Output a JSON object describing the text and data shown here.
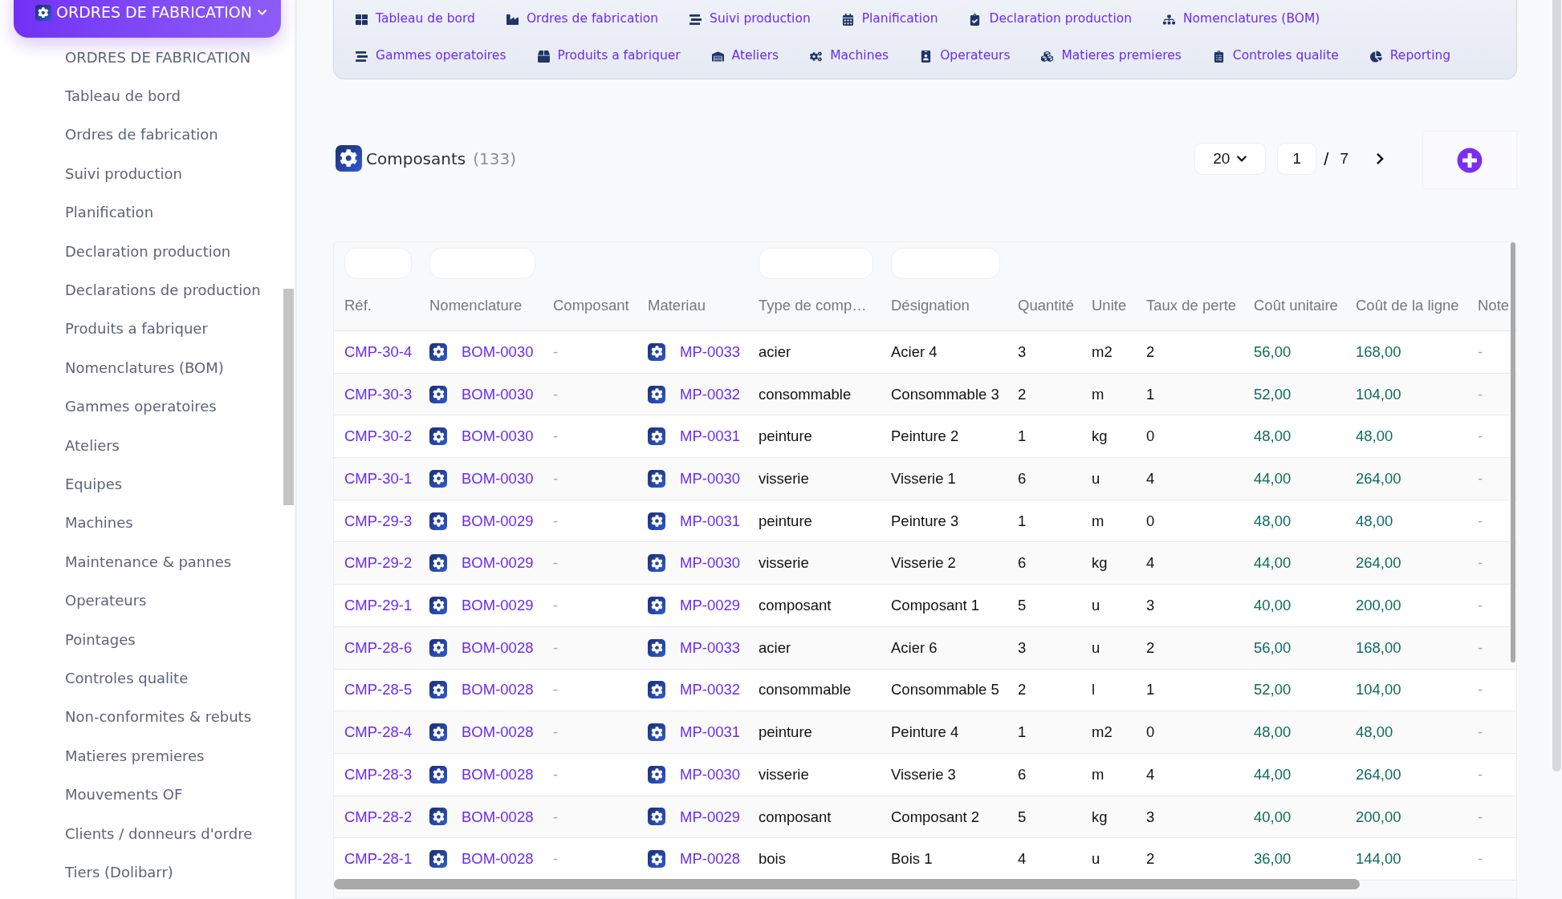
{
  "sidebar": {
    "header": {
      "title": "ORDRES DE FABRICATION"
    },
    "items": [
      "ORDRES DE FABRICATION",
      "Tableau de bord",
      "Ordres de fabrication",
      "Suivi production",
      "Planification",
      "Declaration production",
      "Declarations de production",
      "Produits a fabriquer",
      "Nomenclatures (BOM)",
      "Gammes operatoires",
      "Ateliers",
      "Equipes",
      "Machines",
      "Maintenance & pannes",
      "Operateurs",
      "Pointages",
      "Controles qualite",
      "Non-conformites & rebuts",
      "Matieres premieres",
      "Mouvements OF",
      "Clients / donneurs d'ordre",
      "Tiers (Dolibarr)"
    ]
  },
  "nav": {
    "links": [
      "Tableau de bord",
      "Ordres de fabrication",
      "Suivi production",
      "Planification",
      "Declaration production",
      "Nomenclatures (BOM)",
      "Gammes operatoires",
      "Produits a fabriquer",
      "Ateliers",
      "Machines",
      "Operateurs",
      "Matieres premieres",
      "Controles qualite",
      "Reporting"
    ]
  },
  "section": {
    "title": "Composants",
    "count": "(133)"
  },
  "pagination": {
    "page_size": "20",
    "page": "1",
    "separator": "/",
    "total_pages": "7"
  },
  "table": {
    "columns": [
      {
        "label": "Réf.",
        "kind": "link",
        "filter": true
      },
      {
        "label": "Nomenclature",
        "kind": "icon_link",
        "filter": true
      },
      {
        "label": "Composant",
        "kind": "muted",
        "filter": false
      },
      {
        "label": "Materiau",
        "kind": "icon_link",
        "filter": false
      },
      {
        "label": "Type de comp…",
        "kind": "text",
        "filter": true
      },
      {
        "label": "Désignation",
        "kind": "text",
        "filter": true
      },
      {
        "label": "Quantité",
        "kind": "text",
        "filter": false
      },
      {
        "label": "Unite",
        "kind": "text",
        "filter": false
      },
      {
        "label": "Taux de perte",
        "kind": "text",
        "filter": false
      },
      {
        "label": "Coût unitaire",
        "kind": "amount",
        "filter": false
      },
      {
        "label": "Coût de la ligne",
        "kind": "amount",
        "filter": false
      },
      {
        "label": "Note",
        "kind": "muted",
        "filter": false
      }
    ],
    "rows": [
      [
        "CMP-30-4",
        "BOM-0030",
        "-",
        "MP-0033",
        "acier",
        "Acier 4",
        "3",
        "m2",
        "2",
        "56,00",
        "168,00",
        "-"
      ],
      [
        "CMP-30-3",
        "BOM-0030",
        "-",
        "MP-0032",
        "consommable",
        "Consommable 3",
        "2",
        "m",
        "1",
        "52,00",
        "104,00",
        "-"
      ],
      [
        "CMP-30-2",
        "BOM-0030",
        "-",
        "MP-0031",
        "peinture",
        "Peinture 2",
        "1",
        "kg",
        "0",
        "48,00",
        "48,00",
        "-"
      ],
      [
        "CMP-30-1",
        "BOM-0030",
        "-",
        "MP-0030",
        "visserie",
        "Visserie 1",
        "6",
        "u",
        "4",
        "44,00",
        "264,00",
        "-"
      ],
      [
        "CMP-29-3",
        "BOM-0029",
        "-",
        "MP-0031",
        "peinture",
        "Peinture 3",
        "1",
        "m",
        "0",
        "48,00",
        "48,00",
        "-"
      ],
      [
        "CMP-29-2",
        "BOM-0029",
        "-",
        "MP-0030",
        "visserie",
        "Visserie 2",
        "6",
        "kg",
        "4",
        "44,00",
        "264,00",
        "-"
      ],
      [
        "CMP-29-1",
        "BOM-0029",
        "-",
        "MP-0029",
        "composant",
        "Composant 1",
        "5",
        "u",
        "3",
        "40,00",
        "200,00",
        "-"
      ],
      [
        "CMP-28-6",
        "BOM-0028",
        "-",
        "MP-0033",
        "acier",
        "Acier 6",
        "3",
        "u",
        "2",
        "56,00",
        "168,00",
        "-"
      ],
      [
        "CMP-28-5",
        "BOM-0028",
        "-",
        "MP-0032",
        "consommable",
        "Consommable 5",
        "2",
        "l",
        "1",
        "52,00",
        "104,00",
        "-"
      ],
      [
        "CMP-28-4",
        "BOM-0028",
        "-",
        "MP-0031",
        "peinture",
        "Peinture 4",
        "1",
        "m2",
        "0",
        "48,00",
        "48,00",
        "-"
      ],
      [
        "CMP-28-3",
        "BOM-0028",
        "-",
        "MP-0030",
        "visserie",
        "Visserie 3",
        "6",
        "m",
        "4",
        "44,00",
        "264,00",
        "-"
      ],
      [
        "CMP-28-2",
        "BOM-0028",
        "-",
        "MP-0029",
        "composant",
        "Composant 2",
        "5",
        "kg",
        "3",
        "40,00",
        "200,00",
        "-"
      ],
      [
        "CMP-28-1",
        "BOM-0028",
        "-",
        "MP-0028",
        "bois",
        "Bois 1",
        "4",
        "u",
        "2",
        "36,00",
        "144,00",
        "-"
      ]
    ]
  }
}
